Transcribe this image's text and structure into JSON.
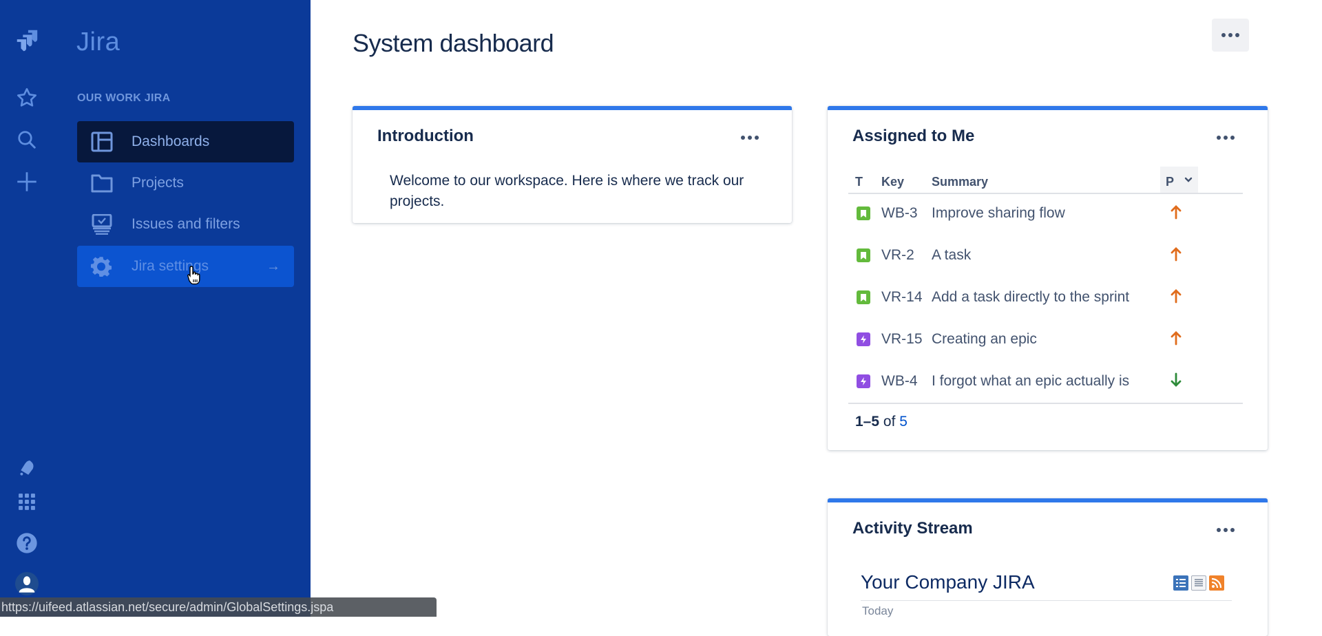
{
  "app": {
    "name": "Jira"
  },
  "sidebar": {
    "global_icons": [
      {
        "name": "jira-logo-icon"
      },
      {
        "name": "star-icon",
        "label": "Starred"
      },
      {
        "name": "search-icon",
        "label": "Search"
      },
      {
        "name": "plus-icon",
        "label": "Create"
      }
    ],
    "bottom_icons": [
      {
        "name": "notification-bell-icon"
      },
      {
        "name": "app-switcher-icon"
      },
      {
        "name": "help-icon"
      },
      {
        "name": "user-avatar-icon"
      }
    ],
    "section_label": "OUR WORK JIRA",
    "items": [
      {
        "label": "Dashboards",
        "icon": "dashboard-icon",
        "state": "active"
      },
      {
        "label": "Projects",
        "icon": "folder-icon",
        "state": "default"
      },
      {
        "label": "Issues and filters",
        "icon": "issues-icon",
        "state": "default"
      },
      {
        "label": "Jira settings",
        "icon": "gear-icon",
        "state": "hover",
        "arrow": "→"
      }
    ]
  },
  "main": {
    "title": "System dashboard",
    "gadgets": {
      "introduction": {
        "title": "Introduction",
        "text": "Welcome to our workspace. Here is where we track our projects."
      },
      "assigned": {
        "title": "Assigned to Me",
        "columns": {
          "type": "T",
          "key": "Key",
          "summary": "Summary",
          "priority": "P"
        },
        "rows": [
          {
            "type": "story",
            "key": "WB-3",
            "summary": "Improve sharing flow",
            "priority": "high"
          },
          {
            "type": "story",
            "key": "VR-2",
            "summary": "A task",
            "priority": "high"
          },
          {
            "type": "story",
            "key": "VR-14",
            "summary": "Add a task directly to the sprint",
            "priority": "high"
          },
          {
            "type": "epic",
            "key": "VR-15",
            "summary": "Creating an epic",
            "priority": "high"
          },
          {
            "type": "epic",
            "key": "WB-4",
            "summary": "I forgot what an epic actually is",
            "priority": "low"
          }
        ],
        "pager": {
          "range": "1–5",
          "of": "of",
          "total": "5"
        }
      },
      "activity": {
        "title": "Activity Stream",
        "stream_title": "Your Company JIRA",
        "day": "Today"
      }
    }
  },
  "colors": {
    "sidebar_bg": "#0b3a99",
    "accent": "#2f78ea",
    "priority_high": "#e06c1c",
    "priority_low": "#2e8b3a",
    "story": "#63ba3c",
    "epic": "#904ee2"
  },
  "statusbar": {
    "url": "https://uifeed.atlassian.net/secure/admin/GlobalSettings.jspa"
  }
}
